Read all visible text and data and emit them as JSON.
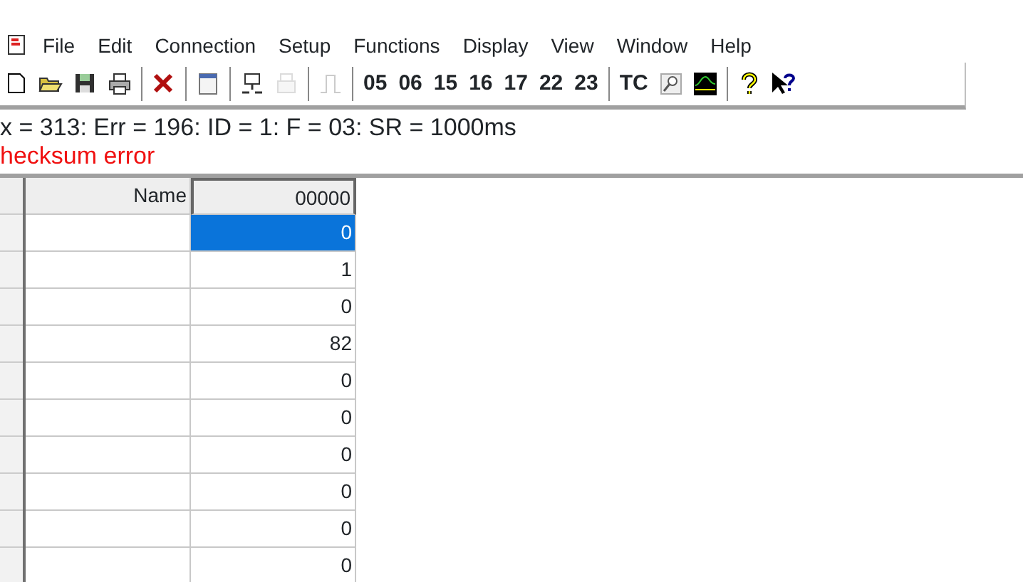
{
  "menu": [
    "File",
    "Edit",
    "Connection",
    "Setup",
    "Functions",
    "Display",
    "View",
    "Window",
    "Help"
  ],
  "toolbar": [
    {
      "kind": "icon",
      "disabled": false
    },
    {
      "kind": "icon",
      "disabled": false
    },
    {
      "kind": "icon",
      "disabled": false
    },
    {
      "kind": "icon",
      "disabled": false
    },
    {
      "kind": "sep"
    },
    {
      "kind": "icon",
      "disabled": false
    },
    {
      "kind": "sep"
    },
    {
      "kind": "icon",
      "disabled": false
    },
    {
      "kind": "sep"
    },
    {
      "kind": "icon",
      "disabled": false
    },
    {
      "kind": "icon",
      "disabled": true
    },
    {
      "kind": "sep"
    },
    {
      "kind": "icon",
      "disabled": true
    },
    {
      "kind": "sep"
    },
    {
      "kind": "text",
      "label": "05"
    },
    {
      "kind": "text",
      "label": "06"
    },
    {
      "kind": "text",
      "label": "15"
    },
    {
      "kind": "text",
      "label": "16"
    },
    {
      "kind": "text",
      "label": "17"
    },
    {
      "kind": "text",
      "label": "22"
    },
    {
      "kind": "text",
      "label": "23"
    },
    {
      "kind": "sep"
    },
    {
      "kind": "text",
      "label": "TC"
    },
    {
      "kind": "icon",
      "disabled": false
    },
    {
      "kind": "icon",
      "disabled": false
    },
    {
      "kind": "sep"
    },
    {
      "kind": "icon",
      "disabled": false
    },
    {
      "kind": "icon",
      "disabled": false
    }
  ],
  "status": {
    "line": "x = 313: Err = 196: ID = 1: F = 03: SR = 1000ms",
    "error": "hecksum error"
  },
  "table": {
    "columns": [
      "Name",
      "00000"
    ],
    "rows": [
      {
        "value": "0",
        "selected": true
      },
      {
        "value": "1",
        "selected": false
      },
      {
        "value": "0",
        "selected": false
      },
      {
        "value": "82",
        "selected": false
      },
      {
        "value": "0",
        "selected": false
      },
      {
        "value": "0",
        "selected": false
      },
      {
        "value": "0",
        "selected": false
      },
      {
        "value": "0",
        "selected": false
      },
      {
        "value": "0",
        "selected": false
      },
      {
        "value": "0",
        "selected": false
      }
    ]
  }
}
